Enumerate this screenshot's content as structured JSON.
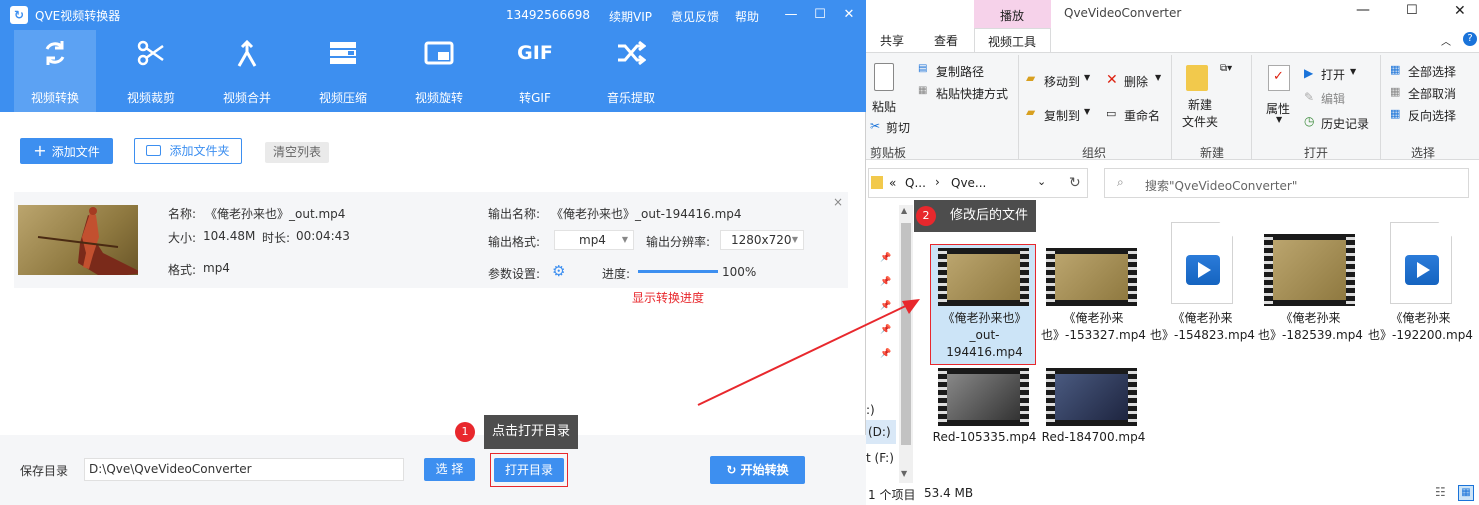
{
  "app": {
    "title": "QVE视频转换器",
    "phone": "13492566698",
    "renew": "续期VIP",
    "feedback": "意见反馈",
    "help": "帮助",
    "tools": [
      {
        "label": "视频转换",
        "icon": "refresh-icon"
      },
      {
        "label": "视频裁剪",
        "icon": "scissors-icon"
      },
      {
        "label": "视频合并",
        "icon": "merge-icon"
      },
      {
        "label": "视频压缩",
        "icon": "compress-icon"
      },
      {
        "label": "视频旋转",
        "icon": "rotate-icon"
      },
      {
        "label": "转GIF",
        "icon": "gif-icon"
      },
      {
        "label": "音乐提取",
        "icon": "shuffle-icon"
      }
    ],
    "add_file": "添加文件",
    "add_folder": "添加文件夹",
    "clear_list": "清空列表",
    "item": {
      "name_label": "名称:",
      "name": "《俺老孙来也》_out.mp4",
      "size_label": "大小:",
      "size": "104.48M",
      "duration_label": "时长:",
      "duration": "00:04:43",
      "format_label": "格式:",
      "format": "mp4",
      "out_name_label": "输出名称:",
      "out_name": "《俺老孙来也》_out-194416.mp4",
      "out_format_label": "输出格式:",
      "out_format": "mp4",
      "resolution_label": "输出分辨率:",
      "resolution": "1280x720",
      "params_label": "参数设置:",
      "progress_label": "进度:",
      "progress": "100%",
      "progress_value": 1.0,
      "progress_note": "显示转换进度"
    },
    "save_dir_label": "保存目录",
    "save_dir": "D:\\Qve\\QveVideoConverter",
    "choose": "选 择",
    "open_dir": "打开目录",
    "start": "开始转换",
    "tip1": "点击打开目录",
    "tip1_num": "1"
  },
  "explorer": {
    "title": "QveVideoConverter",
    "play_tab": "播放",
    "tabs": [
      "共享",
      "查看",
      "视频工具"
    ],
    "paste": "粘贴",
    "copy_path": "复制路径",
    "paste_shortcut": "粘贴快捷方式",
    "cut": "剪切",
    "clipboard": "剪贴板",
    "move_to": "移动到",
    "copy_to": "复制到",
    "delete": "删除",
    "rename": "重命名",
    "organize": "组织",
    "new_folder": "新建\n文件夹",
    "new_group": "新建",
    "properties": "属性",
    "open": "打开",
    "edit": "编辑",
    "history": "历史记录",
    "open_group": "打开",
    "select_all": "全部选择",
    "select_none": "全部取消",
    "invert": "反向选择",
    "select_group": "选择",
    "addr": [
      "«",
      "Q...",
      "›",
      "Qve..."
    ],
    "search_placeholder": "搜索\"QveVideoConverter\"",
    "tip2": "修改后的文件",
    "tip2_num": "2",
    "drives": [
      ":)",
      "(D:)",
      "t (F:)"
    ],
    "files": [
      {
        "name": "《俺老孙来也》_out-194416.mp4",
        "kind": "video-brown",
        "selected": true
      },
      {
        "name": "《俺老孙来也》-153327.mp4",
        "kind": "video-brown",
        "selected": false
      },
      {
        "name": "《俺老孙来也》-154823.mp4",
        "kind": "doc",
        "selected": false
      },
      {
        "name": "《俺老孙来也》-182539.mp4",
        "kind": "video-brown",
        "selected": false
      },
      {
        "name": "《俺老孙来也》-192200.mp4",
        "kind": "doc",
        "selected": false
      },
      {
        "name": "Red-105335.mp4",
        "kind": "video-gray",
        "selected": false
      },
      {
        "name": "Red-184700.mp4",
        "kind": "video-blue",
        "selected": false
      }
    ],
    "status_count": "1 个项目",
    "status_size": "53.4 MB"
  }
}
